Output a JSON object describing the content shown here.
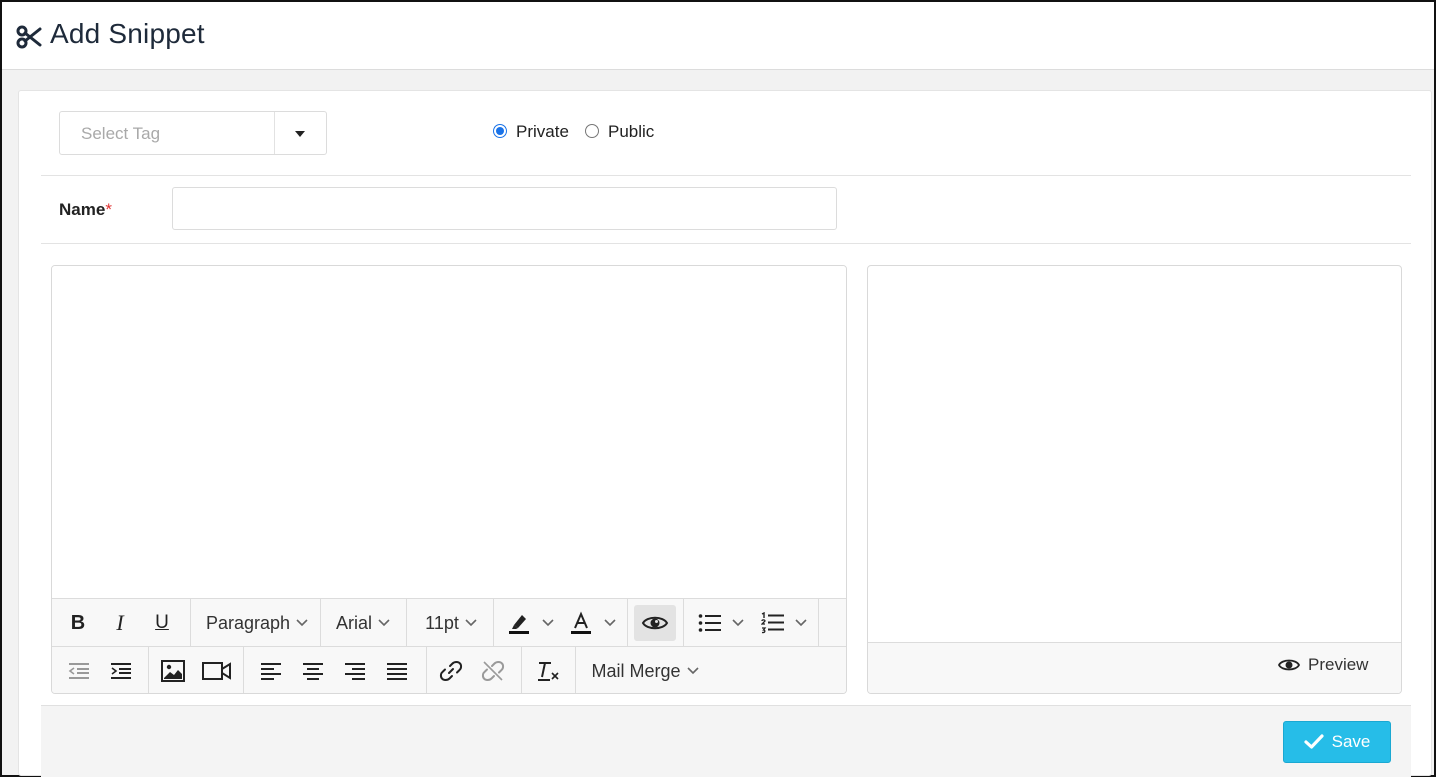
{
  "header": {
    "title": "Add Snippet",
    "icon": "scissors-icon"
  },
  "tag_select": {
    "placeholder": "Select Tag",
    "icon": "caret-down-icon"
  },
  "visibility": {
    "options": [
      "Private",
      "Public"
    ],
    "selected": "Private"
  },
  "name_field": {
    "label": "Name",
    "required_marker": "*",
    "value": ""
  },
  "toolbar": {
    "row1": {
      "bold": "B",
      "italic": "I",
      "underline": "U",
      "block_format": "Paragraph",
      "font_family": "Arial",
      "font_size": "11pt",
      "highlight_icon": "highlight-color-icon",
      "text_color_icon": "text-color-icon",
      "preview_icon": "eye-icon",
      "bullet_list_icon": "bullet-list-icon",
      "numbered_list_icon": "numbered-list-icon"
    },
    "row2": {
      "outdent_icon": "outdent-icon",
      "indent_icon": "indent-icon",
      "image_icon": "image-icon",
      "video_icon": "video-icon",
      "align_left_icon": "align-left-icon",
      "align_center_icon": "align-center-icon",
      "align_right_icon": "align-right-icon",
      "align_justify_icon": "align-justify-icon",
      "link_icon": "link-icon",
      "unlink_icon": "unlink-icon",
      "clear_format_icon": "clear-formatting-icon",
      "mail_merge": "Mail Merge"
    }
  },
  "preview": {
    "button_label": "Preview",
    "icon": "eye-icon"
  },
  "save": {
    "label": "Save",
    "icon": "check-icon"
  },
  "colors": {
    "accent": "#26bde8",
    "radio": "#1a73e8",
    "required": "#e03131"
  }
}
